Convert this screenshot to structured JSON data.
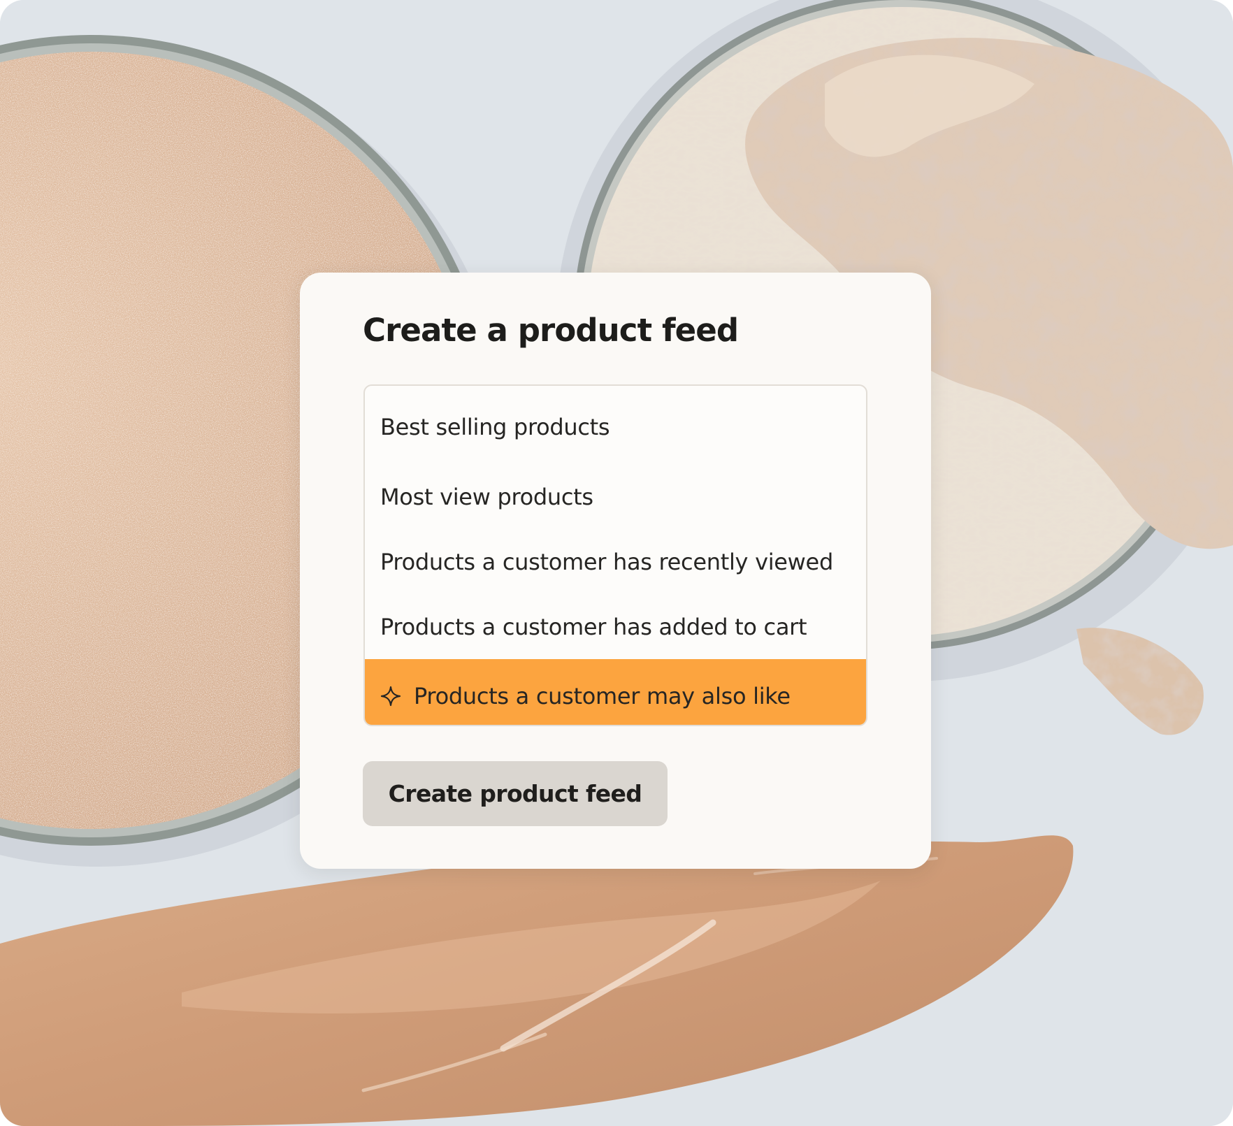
{
  "modal": {
    "title": "Create a product feed",
    "options": [
      {
        "label": "Best selling products",
        "selected": false
      },
      {
        "label": "Most view products",
        "selected": false
      },
      {
        "label": "Products a customer has recently viewed",
        "selected": false
      },
      {
        "label": "Products a customer has added to cart",
        "selected": false
      },
      {
        "label": "Products a customer may also like",
        "selected": true,
        "icon": "sparkle-icon"
      }
    ],
    "create_button_label": "Create product feed"
  },
  "colors": {
    "selected_option": "#fca43f",
    "card_background": "#fbf9f6",
    "button_background": "#dad6d0",
    "page_background": "#dee3e8"
  }
}
